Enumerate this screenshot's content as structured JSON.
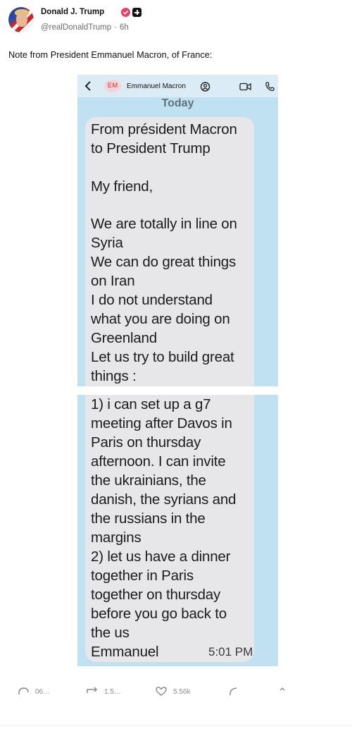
{
  "post": {
    "author_name": "Donald J. Trump",
    "handle": "@realDonaldTrump",
    "time_ago": "6h",
    "text": "Note from President Emmanuel Macron, of France:"
  },
  "chat": {
    "contact_initials": "EM",
    "contact_name": "Emmanuel Macron",
    "date_label": "Today",
    "message_lines_top": [
      "From président Macron",
      "to President Trump",
      "",
      "My friend,",
      "",
      "We are totally in line on",
      "Syria",
      "We can do great things",
      "on Iran",
      "I do not understand",
      "what you are doing on",
      "Greenland",
      "Let us try to build great",
      "things :"
    ],
    "message_lines_bottom": [
      "1) i can set up a g7",
      "meeting after Davos in",
      "Paris on thursday",
      "afternoon. I can invite",
      "the ukrainians, the",
      "danish, the syrians and",
      "the russians in the",
      "margins",
      "2) let us have a dinner",
      "together in Paris",
      "together on thursday",
      "before you go back to",
      "the us",
      "Emmanuel"
    ],
    "timestamp": "5:01 PM"
  },
  "actions": {
    "replies": "06…",
    "reposts": "1.5…",
    "likes": "5.56k"
  },
  "colors": {
    "chat_background": "#bfe1f2",
    "bubble": "#e7e7ea",
    "verified_badge": "#ef3e6b"
  }
}
